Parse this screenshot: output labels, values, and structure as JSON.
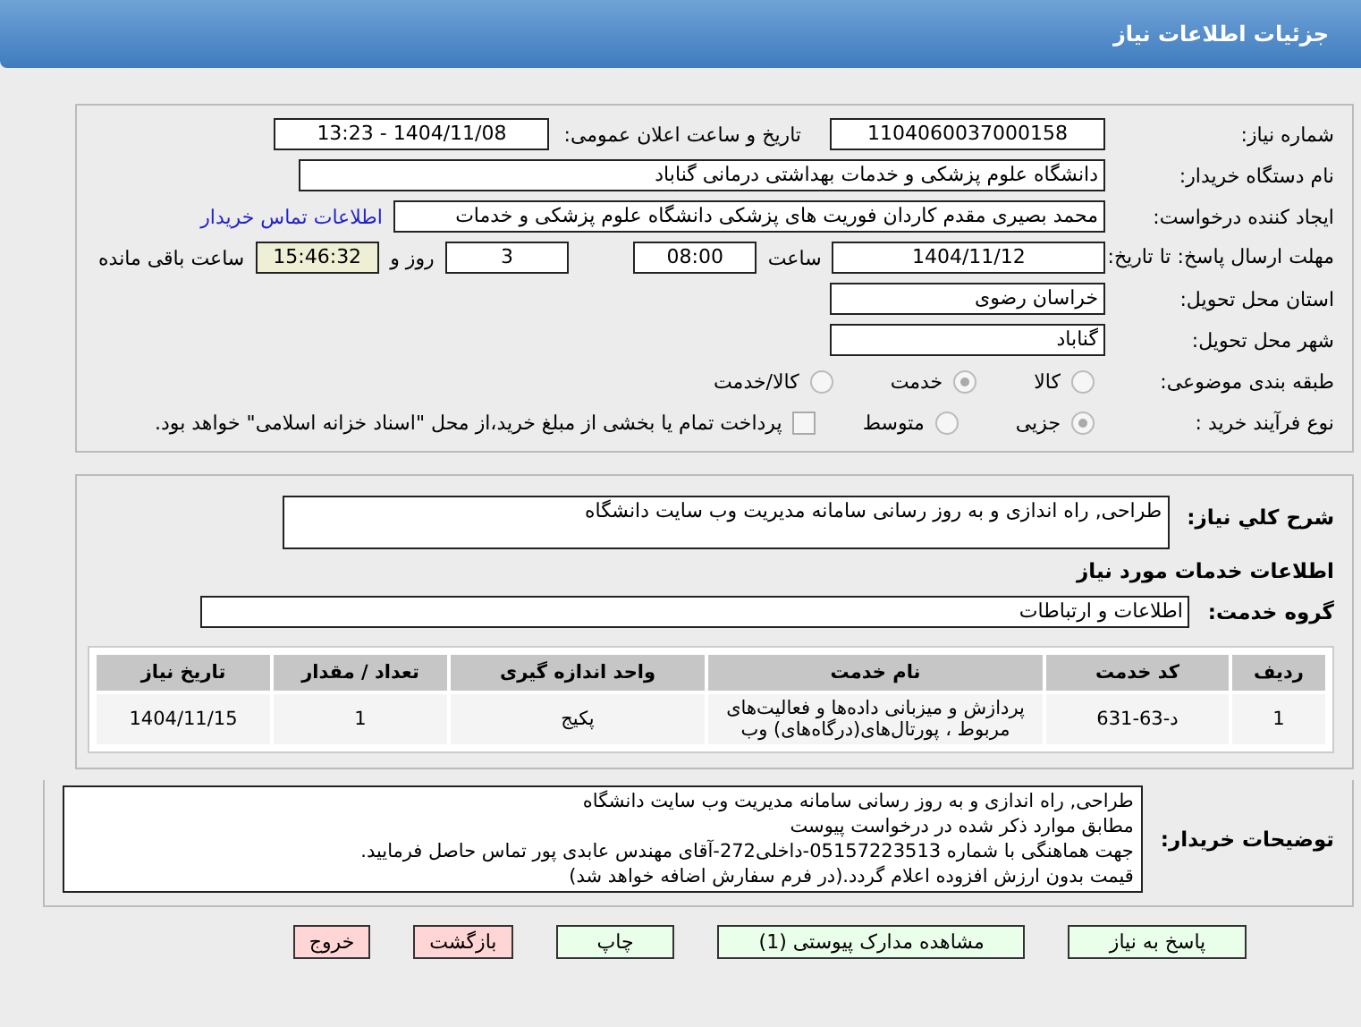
{
  "header": {
    "title": "جزئیات اطلاعات نیاز"
  },
  "need_number": {
    "label": "شماره نیاز:",
    "value": "1104060037000158"
  },
  "announce": {
    "label": "تاریخ و ساعت اعلان عمومی:",
    "value": "1404/11/08 - 13:23"
  },
  "buyer": {
    "label": "نام دستگاه خریدار:",
    "value": "دانشگاه علوم پزشکی و خدمات بهداشتی درمانی گناباد"
  },
  "requester": {
    "label": "ایجاد کننده درخواست:",
    "value": "محمد بصیری مقدم کاردان فوریت های پزشکی دانشگاه علوم پزشکی و خدمات",
    "link": "اطلاعات تماس خریدار"
  },
  "deadline": {
    "label": "مهلت ارسال پاسخ: تا تاریخ:",
    "date": "1404/11/12",
    "time_label": "ساعت",
    "time": "08:00",
    "days": "3",
    "days_label": "روز و",
    "remaining": "15:46:32",
    "remaining_label": "ساعت باقی مانده"
  },
  "province": {
    "label": "استان محل تحویل:",
    "value": "خراسان رضوی"
  },
  "city": {
    "label": "شهر محل تحویل:",
    "value": "گناباد"
  },
  "category": {
    "label": "طبقه بندی موضوعی:",
    "options": [
      {
        "label": "کالا",
        "selected": false
      },
      {
        "label": "خدمت",
        "selected": true
      },
      {
        "label": "کالا/خدمت",
        "selected": false
      }
    ]
  },
  "process": {
    "label": "نوع فرآیند خرید :",
    "options": [
      {
        "label": "جزیی",
        "selected": true
      },
      {
        "label": "متوسط",
        "selected": false
      }
    ],
    "payment": {
      "checked": false,
      "label": "پرداخت تمام یا بخشی از مبلغ خرید،از محل \"اسناد خزانه اسلامی\" خواهد بود."
    }
  },
  "summary": {
    "label": "شرح کلي نياز:",
    "value": "طراحی, راه اندازی و به روز رسانی سامانه مدیریت وب سایت دانشگاه"
  },
  "services_heading": "اطلاعات خدمات مورد نیاز",
  "service_group": {
    "label": "گروه خدمت:",
    "value": "اطلاعات و ارتباطات"
  },
  "table": {
    "columns": [
      "ردیف",
      "کد خدمت",
      "نام خدمت",
      "واحد اندازه گیری",
      "تعداد / مقدار",
      "تاریخ نیاز"
    ],
    "rows": [
      [
        "1",
        "د-63-631",
        "پردازش و میزبانی داده‌ها و فعالیت‌های مربوط ، پورتال‌های(درگاه‌های) وب",
        "پکیج",
        "1",
        "1404/11/15"
      ]
    ]
  },
  "notes": {
    "label": "توضیحات خریدار:",
    "lines": [
      "طراحی, راه اندازی و به روز رسانی سامانه مدیریت وب سایت دانشگاه",
      "مطابق موارد ذکر شده در درخواست پیوست",
      "جهت هماهنگی با شماره 05157223513-داخلی272-آقای مهندس عابدی پور تماس حاصل فرمایید.",
      "قیمت بدون ارزش افزوده اعلام گردد.(در فرم سفارش اضافه خواهد شد)"
    ]
  },
  "buttons": [
    {
      "label": "پاسخ به نیاز",
      "kind": "primary"
    },
    {
      "label": "مشاهده مدارک پیوستی (1)",
      "kind": "primary"
    },
    {
      "label": "چاپ",
      "kind": "primary"
    },
    {
      "label": "بازگشت",
      "kind": "exit"
    },
    {
      "label": "خروج",
      "kind": "exit"
    }
  ]
}
